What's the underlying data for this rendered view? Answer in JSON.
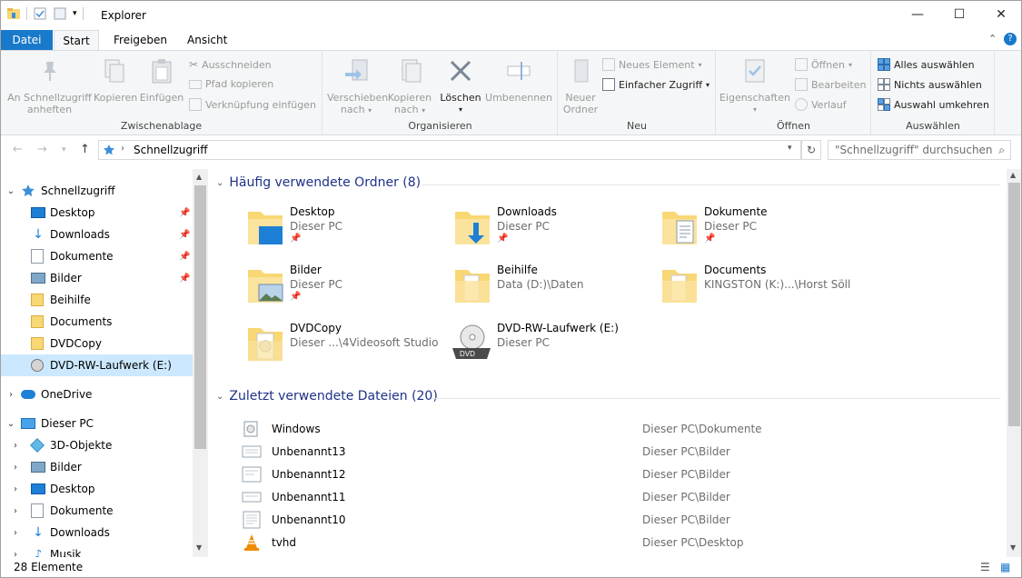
{
  "window": {
    "title": "Explorer",
    "minimize": "—",
    "maximize": "☐",
    "close": "✕"
  },
  "tabs": {
    "datei": "Datei",
    "start": "Start",
    "freigeben": "Freigeben",
    "ansicht": "Ansicht"
  },
  "ribbon": {
    "clipboard": {
      "label": "Zwischenablage",
      "pin_line1": "An Schnellzugriff",
      "pin_line2": "anheften",
      "copy": "Kopieren",
      "paste": "Einfügen",
      "cut": "Ausschneiden",
      "copy_path": "Pfad kopieren",
      "paste_shortcut": "Verknüpfung einfügen"
    },
    "organize": {
      "label": "Organisieren",
      "move_line1": "Verschieben",
      "move_line2": "nach",
      "copyto_line1": "Kopieren",
      "copyto_line2": "nach",
      "delete": "Löschen",
      "rename": "Umbenennen"
    },
    "new": {
      "label": "Neu",
      "folder_line1": "Neuer",
      "folder_line2": "Ordner",
      "new_item": "Neues Element",
      "easy_access": "Einfacher Zugriff"
    },
    "open": {
      "label": "Öffnen",
      "properties": "Eigenschaften",
      "open": "Öffnen",
      "edit": "Bearbeiten",
      "history": "Verlauf"
    },
    "select": {
      "label": "Auswählen",
      "select_all": "Alles auswählen",
      "select_none": "Nichts auswählen",
      "invert": "Auswahl umkehren"
    }
  },
  "address": {
    "crumb": "Schnellzugriff",
    "search_placeholder": "\"Schnellzugriff\" durchsuchen"
  },
  "nav": {
    "quick_access": "Schnellzugriff",
    "qa_items": [
      "Desktop",
      "Downloads",
      "Dokumente",
      "Bilder",
      "Beihilfe",
      "Documents",
      "DVDCopy",
      "DVD-RW-Laufwerk (E:)"
    ],
    "onedrive": "OneDrive",
    "this_pc": "Dieser PC",
    "pc_items": [
      "3D-Objekte",
      "Bilder",
      "Desktop",
      "Dokumente",
      "Downloads",
      "Musik"
    ]
  },
  "frequent": {
    "header": "Häufig verwendete Ordner (8)",
    "items": [
      {
        "name": "Desktop",
        "sub": "Dieser PC"
      },
      {
        "name": "Downloads",
        "sub": "Dieser PC"
      },
      {
        "name": "Dokumente",
        "sub": "Dieser PC"
      },
      {
        "name": "Bilder",
        "sub": "Dieser PC"
      },
      {
        "name": "Beihilfe",
        "sub": "Data (D:)\\Daten"
      },
      {
        "name": "Documents",
        "sub": "KINGSTON (K:)...\\Horst Söll"
      },
      {
        "name": "DVDCopy",
        "sub": "Dieser ...\\4Videosoft Studio"
      },
      {
        "name": "DVD-RW-Laufwerk (E:)",
        "sub": "Dieser PC"
      }
    ]
  },
  "recent": {
    "header": "Zuletzt verwendete Dateien (20)",
    "items": [
      {
        "name": "Windows",
        "path": "Dieser PC\\Dokumente"
      },
      {
        "name": "Unbenannt13",
        "path": "Dieser PC\\Bilder"
      },
      {
        "name": "Unbenannt12",
        "path": "Dieser PC\\Bilder"
      },
      {
        "name": "Unbenannt11",
        "path": "Dieser PC\\Bilder"
      },
      {
        "name": "Unbenannt10",
        "path": "Dieser PC\\Bilder"
      },
      {
        "name": "tvhd",
        "path": "Dieser PC\\Desktop"
      }
    ]
  },
  "status": {
    "count": "28 Elemente"
  },
  "colors": {
    "accent": "#1979ca",
    "folder": "#f8d775",
    "selection": "#cce8ff",
    "heading": "#1e3287"
  }
}
